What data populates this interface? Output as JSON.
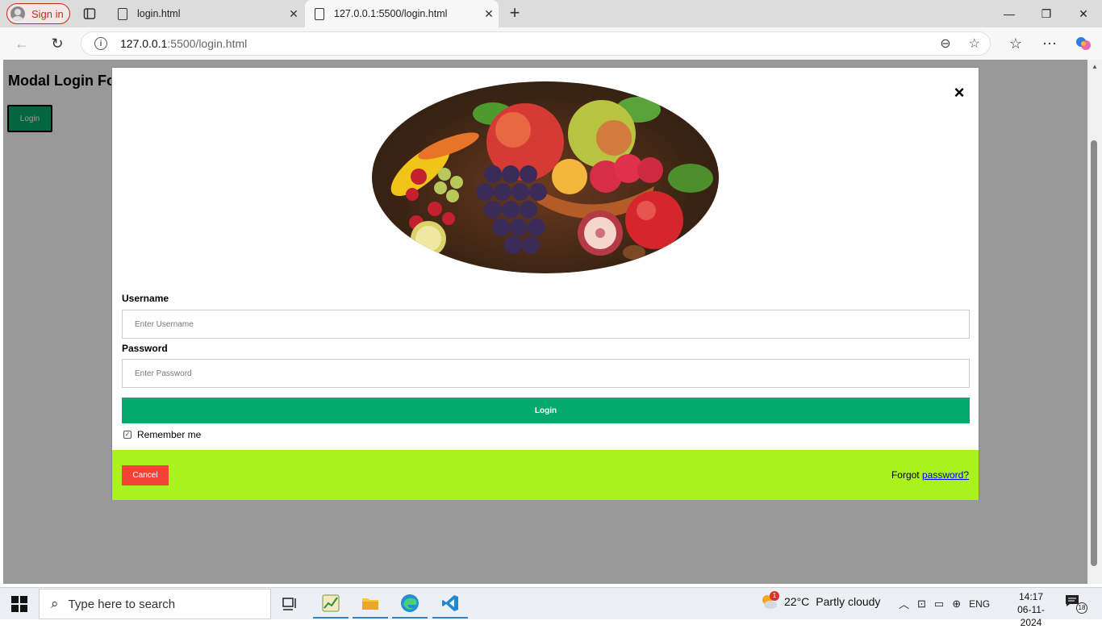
{
  "browser": {
    "profile_label": "Sign in",
    "tabs": [
      {
        "title": "login.html"
      },
      {
        "title": "127.0.0.1:5500/login.html"
      }
    ],
    "address": {
      "host": "127.0.0.1",
      "rest": ":5500/login.html"
    }
  },
  "page": {
    "heading": "Modal Login Fo",
    "open_button": "Login"
  },
  "modal": {
    "close_symbol": "×",
    "image_alt": "fruit-bowl-avatar",
    "username_label": "Username",
    "username_placeholder": "Enter Username",
    "password_label": "Password",
    "password_placeholder": "Enter Password",
    "submit_label": "Login",
    "remember_label": "Remember me",
    "remember_checked": true,
    "cancel_label": "Cancel",
    "forgot_text": "Forgot",
    "forgot_link": "password?",
    "colors": {
      "submit": "#04AA6D",
      "footer": "#aaf21e",
      "cancel": "#f44336"
    }
  },
  "taskbar": {
    "search_placeholder": "Type here to search",
    "weather_badge": "1",
    "temperature": "22°C",
    "weather_text": "Partly cloudy",
    "language": "ENG",
    "time": "14:17",
    "date": "06-11-2024",
    "notification_count": "18"
  }
}
